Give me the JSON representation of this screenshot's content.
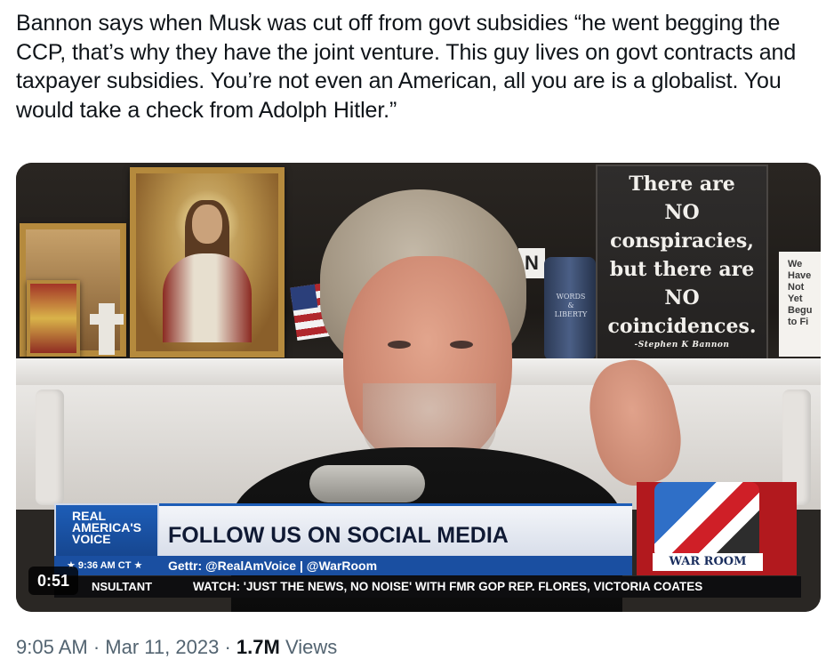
{
  "tweet": {
    "text": "Bannon says when Musk was cut off from govt subsidies “he went begging the CCP, that’s why they have the joint venture. This guy lives on govt contracts and taxpayer subsidies. You’re not even an American, all you are is a globalist. You would take a check from Adolph Hitler.”"
  },
  "video": {
    "duration": "0:51",
    "sign_lines": [
      "There are",
      "NO",
      "conspiracies,",
      "but there are",
      "NO",
      "coincidences."
    ],
    "sign_signature": "-Stephen K Bannon",
    "small_sign_lines": [
      "We",
      "Have",
      "Not",
      "Yet",
      "Begu",
      "to Fi"
    ],
    "mug_text": "WORDS & LIBERTY",
    "small_sign_letter": "N",
    "network_logo": [
      "REAL",
      "AMERICA'S",
      "VOICE"
    ],
    "clock": "9:36 AM CT",
    "headline": "FOLLOW US ON SOCIAL MEDIA",
    "subline": "Gettr: @RealAmVoice | @WarRoom",
    "ticker_label": "NSULTANT",
    "ticker_text": "WATCH: 'JUST THE NEWS, NO NOISE' WITH FMR GOP REP. FLORES, VICTORIA COATES",
    "show_logo": "WAR ROOM"
  },
  "meta": {
    "time": "9:05 AM",
    "separator": "·",
    "date": "Mar 11, 2023",
    "views_count": "1.7M",
    "views_label": "Views"
  }
}
